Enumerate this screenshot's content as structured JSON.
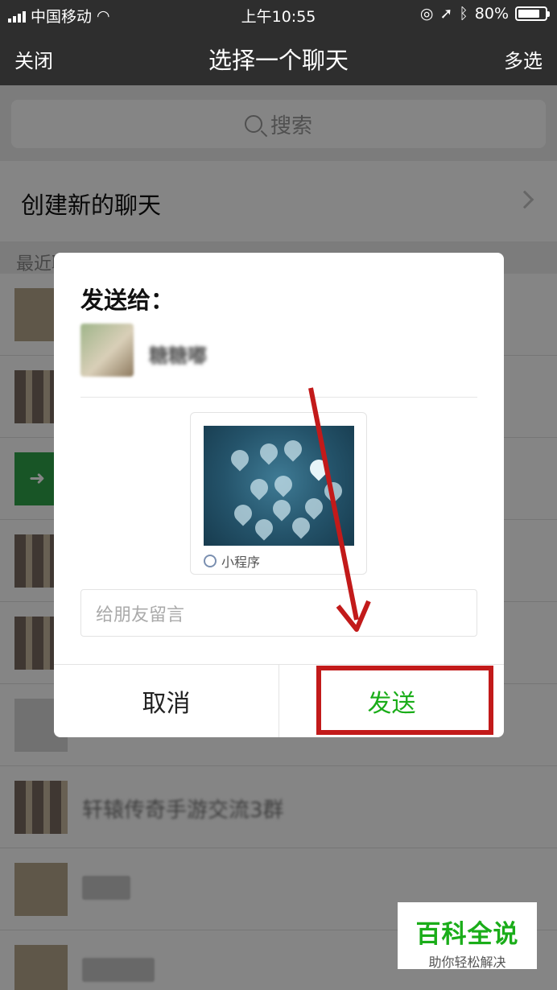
{
  "status_bar": {
    "carrier": "中国移动",
    "time": "上午10:55",
    "battery": "80%",
    "battery_level": 0.8
  },
  "nav": {
    "close_label": "关闭",
    "title": "选择一个聊天",
    "multi_select_label": "多选"
  },
  "search": {
    "placeholder": "搜索"
  },
  "new_chat": {
    "label": "创建新的聊天"
  },
  "recent": {
    "title": "最近聊天"
  },
  "list_rows": [
    {
      "name": ""
    },
    {
      "name": ""
    },
    {
      "name": ""
    },
    {
      "name": ""
    },
    {
      "name": ""
    },
    {
      "name": ""
    },
    {
      "name": "轩辕传奇手游交流3群"
    },
    {
      "name": ""
    },
    {
      "name": ""
    }
  ],
  "dialog": {
    "send_to_label": "发送给：",
    "recipient_name": "糖糖嘟",
    "card_label": "小程序",
    "message_placeholder": "给朋友留言",
    "cancel_label": "取消",
    "send_label": "发送"
  },
  "watermark": {
    "title": "百科全说",
    "subtitle": "助你轻松解决"
  },
  "colors": {
    "nav_bg": "#2e2e2e",
    "accent_green": "#1aad19",
    "annotation_red": "#c21a1a"
  }
}
